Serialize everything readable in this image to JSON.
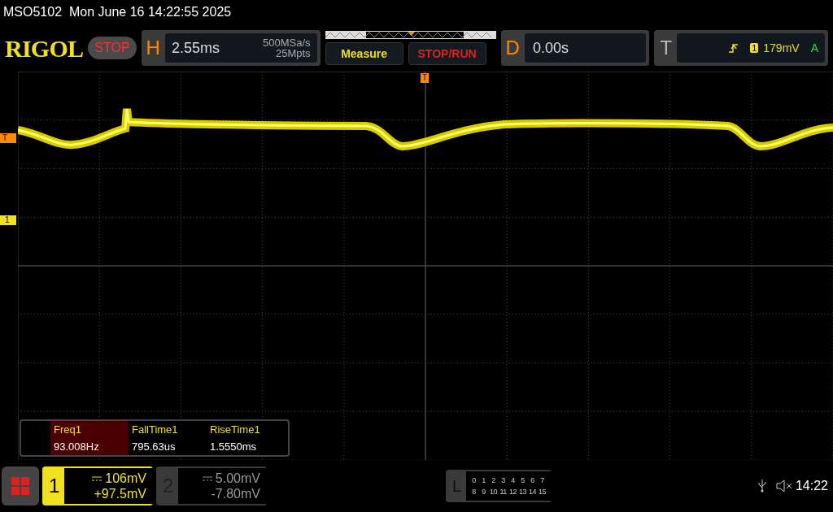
{
  "title_bar": {
    "text": "MSO5102  Mon June 16 14:22:55 2025"
  },
  "top_bar": {
    "logo": "RIGOL",
    "run_state": "STOP",
    "horizontal": {
      "label": "H",
      "timebase": "2.55ms",
      "sample_rate": "500MSa/s",
      "memory_depth": "25Mpts"
    },
    "buttons": [
      {
        "label": "Measure",
        "kind": "measure"
      },
      {
        "label": "STOP/RUN",
        "kind": "run"
      }
    ],
    "delay": {
      "label": "D",
      "value": "0.00s"
    },
    "trigger": {
      "label": "T",
      "source": "1",
      "level": "179mV",
      "mode": "A"
    }
  },
  "markers": {
    "trigger_position": "T",
    "trigger_level": "T",
    "channel": "1"
  },
  "measurements": [
    {
      "label": "Freq1",
      "value": "93.008Hz",
      "selected": true
    },
    {
      "label": "FallTime1",
      "value": "795.63us",
      "selected": false
    },
    {
      "label": "RiseTime1",
      "value": "1.5550ms",
      "selected": false
    }
  ],
  "channels": [
    {
      "number": "1",
      "scale": "106mV",
      "offset": "+97.5mV",
      "selected": true
    },
    {
      "number": "2",
      "scale": "5.00mV",
      "offset": "-7.80mV",
      "selected": false
    }
  ],
  "logic": {
    "label": "L",
    "rows": [
      [
        "0",
        "1",
        "2",
        "3",
        "4",
        "5",
        "6",
        "7"
      ],
      [
        "8",
        "9",
        "10",
        "11",
        "12",
        "13",
        "14",
        "15"
      ]
    ]
  },
  "status": {
    "time": "14:22"
  }
}
